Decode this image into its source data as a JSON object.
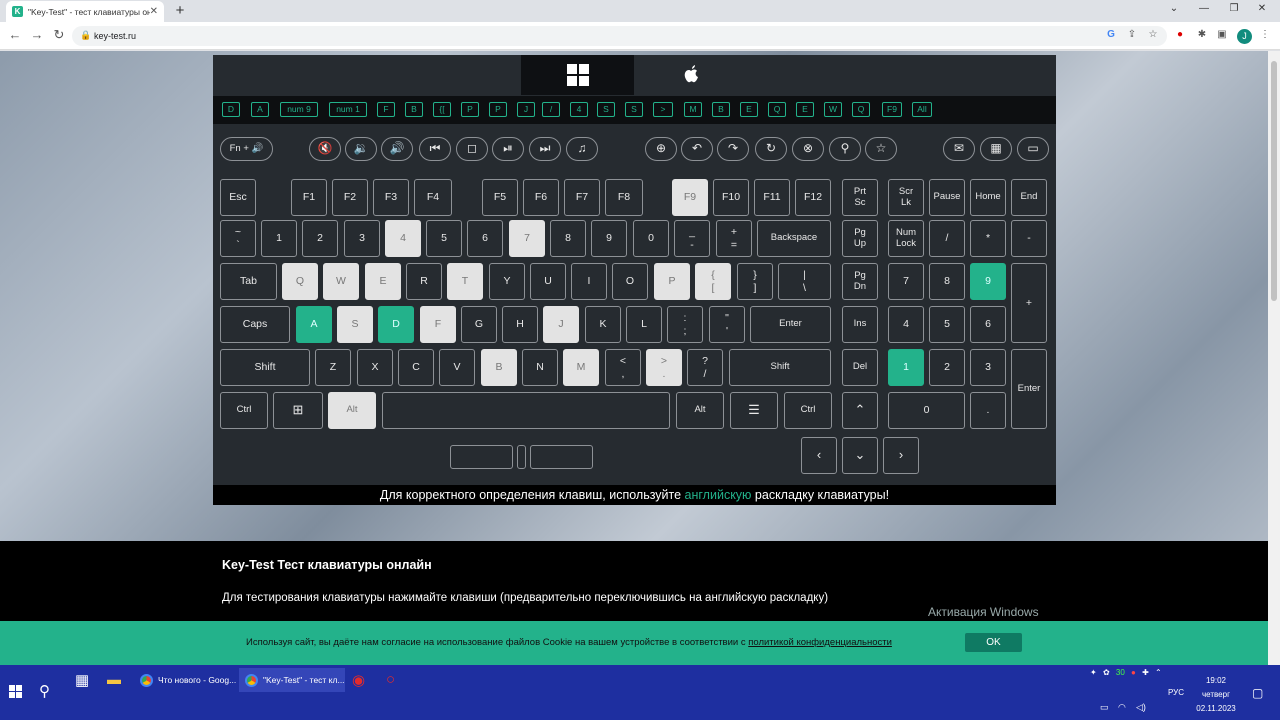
{
  "browser": {
    "tab_title": "\"Key-Test\" - тест клавиатуры он",
    "tab_favicon": "K",
    "url": "key-test.ru",
    "profile_initial": "J"
  },
  "os_tabs": {
    "windows_icon": "windows-logo-icon",
    "apple_icon": "apple-logo-icon"
  },
  "history_keys": [
    "D",
    "A",
    "num 9",
    "num 1",
    "F",
    "B",
    "{[",
    "P",
    "P",
    "J",
    "/",
    "4",
    "S",
    "S",
    ">",
    "M",
    "B",
    "E",
    "Q",
    "E",
    "W",
    "Q",
    "F9",
    "All"
  ],
  "keys": {
    "fn": "Fn + 🔊",
    "esc": "Esc",
    "f1": "F1",
    "f2": "F2",
    "f3": "F3",
    "f4": "F4",
    "f5": "F5",
    "f6": "F6",
    "f7": "F7",
    "f8": "F8",
    "f9": "F9",
    "f10": "F10",
    "f11": "F11",
    "f12": "F12",
    "prtsc": "Prt\nSc",
    "scrlk": "Scr\nLk",
    "pause": "Pause",
    "home": "Home",
    "end": "End",
    "tilde": "~\n`",
    "n1": "1",
    "n2": "2",
    "n3": "3",
    "n4": "4",
    "n5": "5",
    "n6": "6",
    "n7": "7",
    "n8": "8",
    "n9": "9",
    "n0": "0",
    "minus": "_\n-",
    "plus": "+\n=",
    "backspace": "Backspace",
    "pgup": "Pg\nUp",
    "numlock": "Num\nLock",
    "npslash": "/",
    "npstar": "*",
    "npminus": "-",
    "tab": "Tab",
    "q": "Q",
    "w": "W",
    "e": "E",
    "r": "R",
    "t": "T",
    "y": "Y",
    "u": "U",
    "i": "I",
    "o": "O",
    "p": "P",
    "lbr": "{\n[",
    "rbr": "}\n]",
    "bslash": "|\n\\",
    "pgdn": "Pg\nDn",
    "np7": "7",
    "np8": "8",
    "np9": "9",
    "npplus": "+",
    "caps": "Caps",
    "a": "A",
    "s": "S",
    "d": "D",
    "f": "F",
    "g": "G",
    "h": "H",
    "j": "J",
    "k": "K",
    "l": "L",
    "semi": ":\n;",
    "quote": "\"\n'",
    "enter": "Enter",
    "ins": "Ins",
    "np4": "4",
    "np5": "5",
    "np6": "6",
    "shift": "Shift",
    "z": "Z",
    "x": "X",
    "c": "C",
    "v": "V",
    "b": "B",
    "n": "N",
    "m": "M",
    "lt": "<\n,",
    "gt": ">\n.",
    "qm": "?\n/",
    "rshift": "Shift",
    "del": "Del",
    "np1": "1",
    "np2": "2",
    "np3": "3",
    "npenter": "Enter",
    "ctrl": "Ctrl",
    "alt": "Alt",
    "ralt": "Alt",
    "rctrl": "Ctrl",
    "np0": "0",
    "npdot": "."
  },
  "bottom_notice": {
    "before": "Для корректного определения клавиш, используйте ",
    "highlight": "английскую",
    "after": " раскладку клавиатуры!"
  },
  "article": {
    "title": "Key-Test Тест клавиатуры онлайн",
    "text": "Для тестирования клавиатуры нажимайте клавиши (предварительно переключившись на английскую раскладку)"
  },
  "activation": "Активация Windows",
  "cookie": {
    "text": "Используя сайт, вы даёте нам согласие на использование файлов Cookie на вашем устройстве в соответствии с ",
    "link": "политикой конфиденциальности",
    "ok": "OK"
  },
  "taskbar": {
    "app1": "Что нового - Goog...",
    "app2": "\"Key-Test\" - тест кл...",
    "lang": "РУС",
    "time": "19:02",
    "day": "четверг",
    "date": "02.11.2023",
    "tray_num": "30"
  },
  "colors": {
    "accent": "#23b28b",
    "panel": "#262b30",
    "pressed": "#e3e3e3"
  }
}
